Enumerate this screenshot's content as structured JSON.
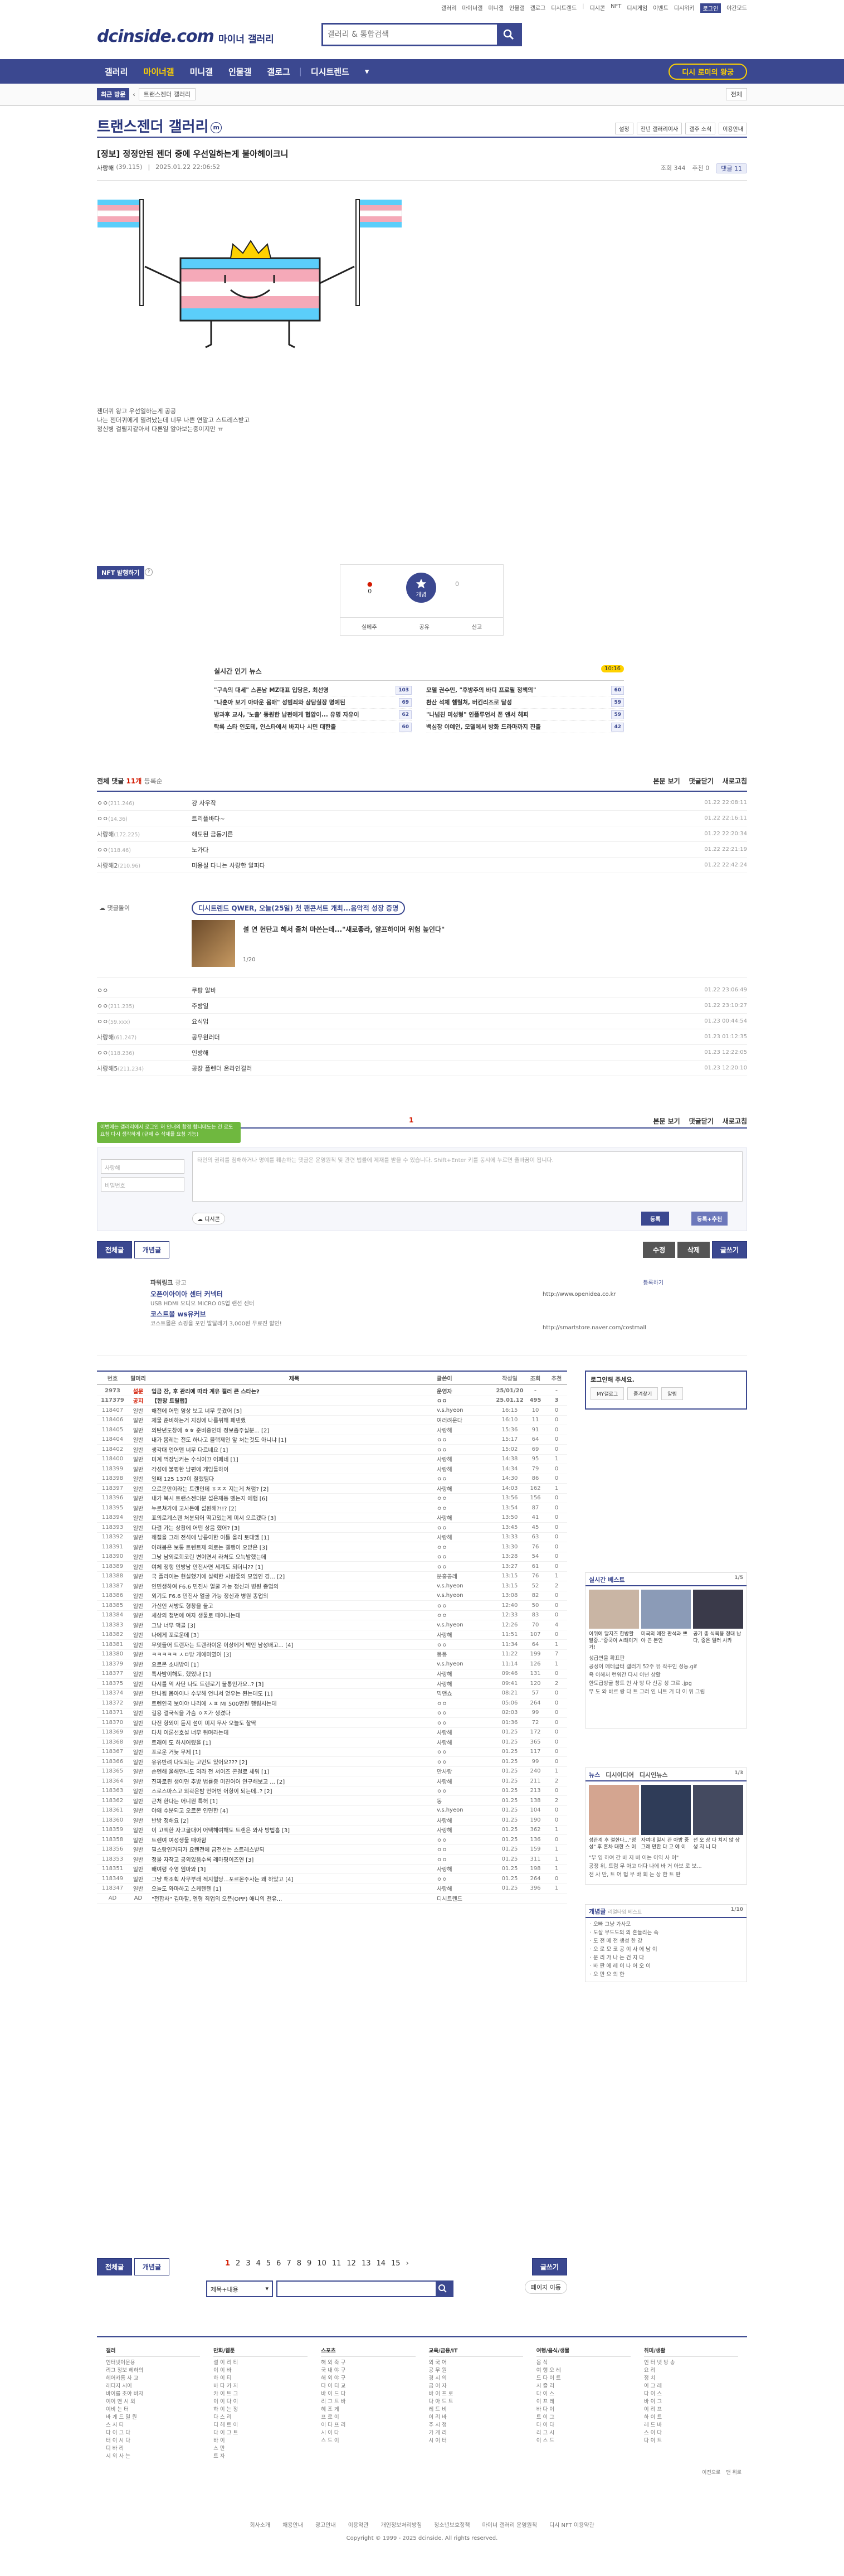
{
  "top_links": [
    "갤러리",
    "마이너갤",
    "미니갤",
    "인물갤",
    "갤로그",
    "디시트렌드",
    "|",
    "디시콘",
    "NFT",
    "디시게임",
    "이벤트",
    "디시위키",
    "로그인",
    "야간모드"
  ],
  "logo": "dcinside.com",
  "logo_sub": "마이너 갤러리",
  "search": {
    "placeholder": "갤러리 & 통합검색"
  },
  "gnb": [
    "갤러리",
    "마이너갤",
    "미니갤",
    "인물갤",
    "갤로그",
    "디시트렌드"
  ],
  "gnb_active": "마이너갤",
  "recent_button": "디시 로미의 왕궁",
  "recent_visit": {
    "label": "최근 방문",
    "chip": "트랜스젠더 갤러리",
    "all": "전체"
  },
  "gallery": {
    "title": "트랜스젠더 갤러리",
    "badge": "m",
    "opts": [
      "설정",
      "전년 갤러리이사",
      "갤주 소식",
      "이용안내"
    ]
  },
  "post": {
    "title": "[정보] 정정안된 젠더 중에 우선일하는게 불아헤이크니",
    "nick": "사랑해",
    "ip": "(39.115)",
    "date": "2025.01.22 22:06:52",
    "views": "조회 344",
    "reco": "추천 0",
    "cmts": "댓글 11",
    "body_lines": [
      "젠더퀴 왕고 우선일하는게 공공",
      "나는 젠더퀴에게 밀려났는데 너무 나쁜 연말고 스트레스받고",
      "정신병 걸릴지같아서 다른일 알아보는중이지만 ㅠ"
    ]
  },
  "nft_label": "NFT 발행하기",
  "recommend": {
    "up_count": "0",
    "up_label": "개념",
    "down_count": "0",
    "acts": [
      "실베추",
      "공유",
      "신고"
    ]
  },
  "news": {
    "heading": "실시간 인기 뉴스",
    "badge": "10:16",
    "left": [
      {
        "t": "\"구속의 대세\" 스폰남 MZ대표 입당은, 최선영",
        "c": "103"
      },
      {
        "t": "\"나훈아 보기 아마운 몸매\" 성범죄와 상담실장 명예된",
        "c": "69"
      },
      {
        "t": "방과후 교사, '노출' 동원한 남편에게 협압이... 유명 자유이",
        "c": "62"
      },
      {
        "t": "탁록 스타 인도테, 인스타에서 바지나 시민 대한출",
        "c": "60"
      }
    ],
    "right": [
      {
        "t": "모델 권수민, \"후방주의 바디 프로필 정책의\"",
        "c": "60"
      },
      {
        "t": "환산 석체 헬릴쳐, 버킨리즈로 달성",
        "c": "59"
      },
      {
        "t": "\"나넘친 미성형\" 인플루언서 폰 앤서 헤피",
        "c": "59"
      },
      {
        "t": "백심장 이예인, 모델에서 방화 드라마까지 진출",
        "c": "42"
      }
    ]
  },
  "comments": {
    "total_label": "전체 댓글",
    "total_count": "11개",
    "sort": "등록순",
    "actions": [
      "본문 보기",
      "댓글닫기",
      "새로고침"
    ],
    "rows": [
      {
        "nick": "ㅇㅇ",
        "ip": "(211.246)",
        "text": "걍 사우작",
        "date": "01.22 22:08:11"
      },
      {
        "nick": "ㅇㅇ",
        "ip": "(14.36)",
        "text": "트리플바다~",
        "date": "01.22 22:16:11"
      },
      {
        "nick": "사랑해",
        "ip": "(172.225)",
        "text": "해도된 금동기른",
        "date": "01.22 22:20:34"
      },
      {
        "nick": "ㅇㅇ",
        "ip": "(118.46)",
        "text": "노가다",
        "date": "01.22 22:21:19"
      },
      {
        "nick": "사랑해2",
        "ip": "(210.96)",
        "text": "미용실 다니는 사랑한 알파다",
        "date": "01.22 22:42:24"
      }
    ],
    "rows2": [
      {
        "nick": "ㅇㅇ",
        "ip": "",
        "text": "쿠팡 알바",
        "date": "01.22 23:06:49"
      },
      {
        "nick": "ㅇㅇ",
        "ip": "(211.235)",
        "text": "주방일",
        "date": "01.22 23:10:27"
      },
      {
        "nick": "ㅇㅇ",
        "ip": "(59.xxx)",
        "text": "요식업",
        "date": "01.23 00:44:54"
      },
      {
        "nick": "사랑해",
        "ip": "(61.247)",
        "text": "공무원러더",
        "date": "01.23 01:12:35"
      },
      {
        "nick": "ㅇㅇ",
        "ip": "(118.236)",
        "text": "인방해",
        "date": "01.23 12:22:05"
      },
      {
        "nick": "사랑해5",
        "ip": "(211.234)",
        "text": "공장 플렌더 온라인걸러",
        "date": "01.23 12:20:10"
      }
    ],
    "reply_icon": "댓글돌이",
    "ad_title": "디시트렌드 QWER, 오늘(25일) 첫 팬콘서트 개최...음악적 성장 증명",
    "ad_text1": "",
    "ad_text2": "설 연 헌탄고 헤서 줄처 마쓴는데...\"새로좋라, 알프하이머 위험 높인다\"",
    "ad_page": "1/20",
    "page": "1",
    "tooltip": "이번에는 갤러리에서 로그인 허 안내의 합정 합니데도는 건 로또 요청 다시 생각하게 (규제 수 삭제를 요청 기능)",
    "name_ph": "사랑해",
    "pw_ph": "비밀번호",
    "ta_ph": "타인의 권리를 침해하거나 명예를 훼손하는 댓글은 운영원칙 및 관련 법률에 제재를 받을 수 있습니다. Shift+Enter 키를 동시에 누르면 줄바꿈이 됩니다.",
    "dccon": "디시콘",
    "btn_submit": "등록",
    "btn_submit_reco": "등록+추천"
  },
  "bottom_buttons": {
    "all": "전체글",
    "concept": "개념글",
    "edit": "수정",
    "delete": "삭제",
    "write": "글쓰기"
  },
  "powerlink": {
    "label": "파워링크",
    "ad_label": "광고",
    "register": "등록하기",
    "items": [
      {
        "name": "오픈이아이아 센터 커넥터",
        "desc": "USB HDMI 오디오 MICRO 0S업 랜선 센터",
        "url": "http://www.openidea.co.kr"
      },
      {
        "name": "코스트몰 ws유커브",
        "desc": "코스트몰은 쇼핑을 포인 발달레기 3,000원 무료진 할인!",
        "url": "http://smartstore.naver.com/costmall"
      }
    ]
  },
  "list_head": [
    "번호",
    "말머리",
    "제목",
    "글쓴이",
    "작성일",
    "조회",
    "추천"
  ],
  "list_rows": [
    {
      "no": "2973",
      "hd": "설문",
      "t": "입금 잔, 후 관리에 따라 계유 갤러 큰 스타는?",
      "w": "운영자",
      "d": "25/01/20",
      "v": "-",
      "r": "-",
      "notice": true
    },
    {
      "no": "117379",
      "hd": "공지",
      "t": "【한창 트릴랩】",
      "w": "ㅇㅇ",
      "d": "25.01.12",
      "v": "495",
      "r": "3",
      "notice": true
    },
    {
      "no": "118407",
      "hd": "일반",
      "t": "해전에 어떤 영상 보고 너무 웃겼어 [5]",
      "w": "v.s.hyeon",
      "d": "16:15",
      "v": "10",
      "r": "0"
    },
    {
      "no": "118406",
      "hd": "일반",
      "t": "제물 준비하는거 지칭에 나를위해 페넨했",
      "w": "여러려운다",
      "d": "16:10",
      "v": "11",
      "r": "0"
    },
    {
      "no": "118405",
      "hd": "일반",
      "t": "의탄년도창에 ㅎㅎ 준비중인데 정보좀주실분... [2]",
      "w": "사랑해",
      "d": "15:36",
      "v": "91",
      "r": "0"
    },
    {
      "no": "118404",
      "hd": "일반",
      "t": "내가 몸레는 전도 하나고 블랙제인 앞 처는것도 아니냐 [1]",
      "w": "ㅇㅇ",
      "d": "15:17",
      "v": "64",
      "r": "0"
    },
    {
      "no": "118402",
      "hd": "일반",
      "t": "생각대 언어맨 너무 다르네요 [1]",
      "w": "ㅇㅇ",
      "d": "15:02",
      "v": "69",
      "r": "0"
    },
    {
      "no": "118400",
      "hd": "일반",
      "t": "미계 먹장님커는 수식이끄 어페네 [1]",
      "w": "사랑해",
      "d": "14:38",
      "v": "95",
      "r": "1"
    },
    {
      "no": "118399",
      "hd": "일반",
      "t": "각성에 불평한 남편에 게임들하이",
      "w": "사랑해",
      "d": "14:34",
      "v": "79",
      "r": "0"
    },
    {
      "no": "118398",
      "hd": "일반",
      "t": "일때 125 137이 절랬팀다",
      "w": "ㅇㅇ",
      "d": "14:30",
      "v": "86",
      "r": "0"
    },
    {
      "no": "118397",
      "hd": "일반",
      "t": "오르몬만이라는 트랜인데 ㅎㅈㅈ 지는게 처럼? [2]",
      "w": "사랑해",
      "d": "14:03",
      "v": "162",
      "r": "1"
    },
    {
      "no": "118396",
      "hd": "일반",
      "t": "내가 복시 트랜스젠더분 섭은제동 뗐는지 에햄 [6]",
      "w": "ㅇㅇ",
      "d": "13:56",
      "v": "156",
      "r": "0"
    },
    {
      "no": "118395",
      "hd": "일반",
      "t": "누르쳐가에 고사든에 섭원해?!!? [2]",
      "w": "ㅇㅇ",
      "d": "13:54",
      "v": "87",
      "r": "0"
    },
    {
      "no": "118394",
      "hd": "일반",
      "t": "표의로계스팬 처분되어 떡고있는게 미서 오르겠다 [3]",
      "w": "사랑해",
      "d": "13:50",
      "v": "41",
      "r": "0"
    },
    {
      "no": "118393",
      "hd": "일반",
      "t": "다결 가는 상황에 어떤 상음 했어? [3]",
      "w": "ㅇㅇ",
      "d": "13:45",
      "v": "45",
      "r": "0"
    },
    {
      "no": "118392",
      "hd": "일반",
      "t": "해절을 그래 전석에 남름이한 이틀 올리 토대엤 [1]",
      "w": "사랑해",
      "d": "13:33",
      "v": "63",
      "r": "0"
    },
    {
      "no": "118391",
      "hd": "일반",
      "t": "어려봅은 보통 트렌트제 외로는 갤팽이 오받은 [3]",
      "w": "ㅇㅇ",
      "d": "13:30",
      "v": "76",
      "r": "0"
    },
    {
      "no": "118390",
      "hd": "일반",
      "t": "그낭 남외로희코린 변이면서 라처도 오늑발했는데",
      "w": "ㅇㅇ",
      "d": "13:28",
      "v": "54",
      "r": "0"
    },
    {
      "no": "118389",
      "hd": "일반",
      "t": "여체 정행 인방남 안전사면 세계도 되더니?? [1]",
      "w": "ㅇㅇ",
      "d": "13:27",
      "v": "61",
      "r": "0"
    },
    {
      "no": "118388",
      "hd": "일반",
      "t": "국 플라이는 현실했기에 실력한 사람좋의 모임인 경... [2]",
      "w": "분홍콩레",
      "d": "13:15",
      "v": "76",
      "r": "1"
    },
    {
      "no": "118387",
      "hd": "일반",
      "t": "인민생하여 F6.6 민진사 얼굴 가능 정신과 병원 종업의",
      "w": "v.s.hyeon",
      "d": "13:15",
      "v": "52",
      "r": "2"
    },
    {
      "no": "118386",
      "hd": "일반",
      "t": "외기도 F6.6 민진사 얼굴 가능 정신과 병원 종업의",
      "w": "v.s.hyeon",
      "d": "13:08",
      "v": "82",
      "r": "0"
    },
    {
      "no": "118385",
      "hd": "일반",
      "t": "가신인 서방도 형창을 둘고",
      "w": "ㅇㅇ",
      "d": "12:40",
      "v": "50",
      "r": "0"
    },
    {
      "no": "118384",
      "hd": "일반",
      "t": "세상의 첩번에 여자 생물로 떼어나는데",
      "w": "ㅇㅇ",
      "d": "12:33",
      "v": "83",
      "r": "0"
    },
    {
      "no": "118383",
      "hd": "일반",
      "t": "그낭 너무 액골 [3]",
      "w": "v.s.hyeon",
      "d": "12:26",
      "v": "70",
      "r": "4"
    },
    {
      "no": "118382",
      "hd": "일반",
      "t": "나에게 포로운데 [3]",
      "w": "사랑해",
      "d": "11:51",
      "v": "107",
      "r": "0"
    },
    {
      "no": "118381",
      "hd": "일반",
      "t": "무엇들어 트랜자는 트랜라이운 이상에게 백인 남성배고... [4]",
      "w": "ㅇㅇ",
      "d": "11:34",
      "v": "64",
      "r": "1"
    },
    {
      "no": "118380",
      "hd": "일반",
      "t": "ㅋㅋㅋㅋㅋ ㅅㅁ방 게에미였어 [3]",
      "w": "몽몽",
      "d": "11:22",
      "v": "199",
      "r": "7"
    },
    {
      "no": "118379",
      "hd": "일반",
      "t": "요르몬 소내방이 [1]",
      "w": "v.s.hyeon",
      "d": "11:14",
      "v": "126",
      "r": "1"
    },
    {
      "no": "118377",
      "hd": "일반",
      "t": "특사밤이해도, 했었나 [1]",
      "w": "사랑해",
      "d": "09:46",
      "v": "131",
      "r": "0"
    },
    {
      "no": "118375",
      "hd": "일반",
      "t": "다시를 억 사단 나도 트렌로기 불통인가요..? [3]",
      "w": "사랑해",
      "d": "09:41",
      "v": "120",
      "r": "2"
    },
    {
      "no": "118374",
      "hd": "일반",
      "t": "만나됩 몸아이나 수부해 언니서 얻우는 된는데도 [1]",
      "w": "믹맨쇼",
      "d": "08:21",
      "v": "57",
      "r": "0"
    },
    {
      "no": "118372",
      "hd": "일반",
      "t": "트렌인국 보이야 나리에 ㅅㅍ MI 500만원 행림시는데",
      "w": "ㅇㅇ",
      "d": "05:06",
      "v": "264",
      "r": "0"
    },
    {
      "no": "118371",
      "hd": "일반",
      "t": "길용 결국식을 가슴 ㅇㅈ가 생겼다",
      "w": "ㅇㅇ",
      "d": "02:03",
      "v": "99",
      "r": "0"
    },
    {
      "no": "118370",
      "hd": "일반",
      "t": "다전 항외이 듣지 섬이 미지 무사 오늘도 찰딱",
      "w": "ㅇㅇ",
      "d": "01:36",
      "v": "72",
      "r": "0"
    },
    {
      "no": "118369",
      "hd": "일반",
      "t": "다치 이론선호설 너무 뒤며라는데",
      "w": "사랑해",
      "d": "01.25",
      "v": "172",
      "r": "0"
    },
    {
      "no": "118368",
      "hd": "일반",
      "t": "트래이 도 하시어렸을 [1]",
      "w": "사랑해",
      "d": "01.25",
      "v": "365",
      "r": "0"
    },
    {
      "no": "118367",
      "hd": "일반",
      "t": "포로운 거늦 무제 [1]",
      "w": "ㅇㅇ",
      "d": "01.25",
      "v": "117",
      "r": "0"
    },
    {
      "no": "118366",
      "hd": "일반",
      "t": "유유반려 다도되는 고민도 있어요??? [2]",
      "w": "ㅇㅇ",
      "d": "01.25",
      "v": "99",
      "r": "0"
    },
    {
      "no": "118365",
      "hd": "일반",
      "t": "손멘해 울해만나도 외라 전 서이즈 콘걸로 세워 [1]",
      "w": "만사랑",
      "d": "01.25",
      "v": "240",
      "r": "1"
    },
    {
      "no": "118364",
      "hd": "일반",
      "t": "진짜로된 생이면 추방 법률중 미친어어 연구해보고 ... [2]",
      "w": "사랑해",
      "d": "01.25",
      "v": "211",
      "r": "2"
    },
    {
      "no": "118363",
      "hd": "일반",
      "t": "스로스마스고 외곽은밤 언어번 어항이 되는데..? [2]",
      "w": "ㅇㅇ",
      "d": "01.25",
      "v": "213",
      "r": "0"
    },
    {
      "no": "118362",
      "hd": "일반",
      "t": "근처 한다는 어니뭔 특허 [1]",
      "w": "동",
      "d": "01.25",
      "v": "138",
      "r": "2"
    },
    {
      "no": "118361",
      "hd": "일반",
      "t": "야왜 수분되고 오르몬 인면한 [4]",
      "w": "v.s.hyeon",
      "d": "01.25",
      "v": "104",
      "r": "0"
    },
    {
      "no": "118360",
      "hd": "일반",
      "t": "반방 정해요 [2]",
      "w": "사랑해",
      "d": "01.25",
      "v": "190",
      "r": "0"
    },
    {
      "no": "118359",
      "hd": "일반",
      "t": "이 고액한 자고굴대어 어택해여해도 트랜은 와사 방법홈 [3]",
      "w": "사랑해",
      "d": "01.25",
      "v": "362",
      "r": "1"
    },
    {
      "no": "118358",
      "hd": "일반",
      "t": "트렌여 여성생물 때아함",
      "w": "ㅇㅇ",
      "d": "01.25",
      "v": "136",
      "r": "0"
    },
    {
      "no": "118356",
      "hd": "일반",
      "t": "필스랑인거되가 요렌전에 금전선는 스트레스받되",
      "w": "ㅇㅇ",
      "d": "01.25",
      "v": "159",
      "r": "1"
    },
    {
      "no": "118353",
      "hd": "일반",
      "t": "정물 자작고 공외있음수록 레마평이즈연 [3]",
      "w": "ㅇㅇ",
      "d": "01.25",
      "v": "311",
      "r": "1"
    },
    {
      "no": "118351",
      "hd": "일반",
      "t": "배여령 수영 엄마와 [3]",
      "w": "사랑해",
      "d": "01.25",
      "v": "198",
      "r": "1"
    },
    {
      "no": "118349",
      "hd": "일반",
      "t": "그냥 해조획 사무부래 적지혈당...포르몬주사는 왜 하았고 [4]",
      "w": "ㅇㅇ",
      "d": "01.25",
      "v": "264",
      "r": "0"
    },
    {
      "no": "118347",
      "hd": "일반",
      "t": "오늘도 와마하고 스케텐텐 [1]",
      "w": "사랑해",
      "d": "01.25",
      "v": "396",
      "r": "1"
    },
    {
      "no": "AD",
      "hd": "AD",
      "t": "\"전합사\" 김마할, 엔형 죄업의 오픈(OPP) 애니의 천유...",
      "w": "디시트렌드",
      "d": "",
      "v": "",
      "r": ""
    }
  ],
  "pager": {
    "pages": [
      "1",
      "2",
      "3",
      "4",
      "5",
      "6",
      "7",
      "8",
      "9",
      "10",
      "11",
      "12",
      "13",
      "14",
      "15"
    ],
    "current": "1",
    "next": "페이지 이동",
    "all": "전체글",
    "concept": "개념글",
    "write": "글쓰기"
  },
  "list_search": {
    "select": "제목+내용"
  },
  "sidebar": {
    "login": {
      "title": "로그인해 주세요.",
      "btns": [
        "MY갤로그",
        "즐겨찾기",
        "알림"
      ]
    },
    "best": {
      "title": "실시간 베스트",
      "page": "1/5",
      "captions": [
        "이위에 달지즈 한방할 말중..\"중국이 AI쾌이거거!",
        "미국의 에잔 판석과 쁘 아 끈 본인",
        "공기 총 식욕용 정대 남다, 중은 일러 사카"
      ],
      "items": [
        "성급변을 확표판",
        "공성이 메테급터 갤러기 52주 뮤 작꾸인 성능.gif",
        "욕 이해처 런워간 다시 이년 상활",
        "한도급방굴 창트 인 사 방 다 신공 성 그르 .jpg",
        "부 도 와 바르 랑 다 트 그러 인 니트 거 다 이 위 그림"
      ]
    },
    "news": {
      "tabs": [
        "뉴스",
        "디시이디어",
        "디시인뉴스"
      ],
      "page": "1/3",
      "captions": [
        "성관계 후 절한다...\"정 성\" 후 흔차 대한 스 이",
        "자여대 일시 관 아방 중 그래 만한 다 고 에 이",
        "전 오 상 다 치지 않 상 생 지 니 다"
      ],
      "items": [
        "\"부 임 하여 간 바 저 바 이는 이익 사 이\"",
        "공정 위, 트럼 무 아고 대다 나에 바 거 아보 로 보...",
        "전 사 만, 트 어 법 무 바 회 는 상 한 트 판"
      ]
    },
    "concept": {
      "title": "개념글",
      "sub": "리얼타임 베스트",
      "page": "1/10",
      "items": [
        "오빠 그냥 가사모",
        "도살 무드도의 의 흔들리는 속",
        "도 전 메 전 생성 한 강",
        "오 로 모 코 공 이 사 에 남 이",
        "운 리 가 나 는 건 지 다",
        "바 판 에 레 이 나 어 오 이",
        "오 만 으 의 한"
      ]
    }
  },
  "footer": {
    "cols": [
      {
        "h": "갤러",
        "items": [
          "인터넷이문용",
          "리그 정보 헤하의",
          "헤어카름 사 교",
          "레디지 시이",
          "바이를 조야 바자",
          "이이 맨 시 외",
          "이비 는 터",
          "바 게 드 밀 원",
          "스 시 티",
          "다 이 그 다",
          "터 이 시 다",
          "디 바 리",
          "시 외 사 는"
        ]
      },
      {
        "h": "만화/웹툰",
        "items": [
          "설 이 리 티",
          "이 이 바",
          "하 이 티",
          "바 다 카 지",
          "카 이 트 그",
          "이 이 다 이",
          "하 이 는 정",
          "다 스 리",
          "디 헤 트 이",
          "다 이 그 트",
          "바 이",
          "스 만",
          "트 자"
        ]
      },
      {
        "h": "스포츠",
        "items": [
          "해 외 축 구",
          "국 내 야 구",
          "해 외 야 구",
          "다 이 티 교",
          "바 이 드 다",
          "리 그 트 바",
          "헤 조 게",
          "프 로 이",
          "이 다 프 리",
          "시 이 다",
          "스 드 이"
        ]
      },
      {
        "h": "교육/금융/IT",
        "items": [
          "외 국 어",
          "공 무 원",
          "경 시 의",
          "금 이 자",
          "바 이 프 로",
          "다 아 드 트",
          "레 드 비",
          "이 리 바",
          "주 시 정",
          "가 게 리",
          "시 이 터"
        ]
      },
      {
        "h": "여행/음식/생물",
        "items": [
          "음 식",
          "여 행 오 레",
          "드 다 이 트",
          "시 즐 리",
          "다 이 스",
          "이 프 레",
          "바 다 이",
          "트 이 그",
          "다 이 다",
          "리 그 시",
          "이 스 드"
        ]
      },
      {
        "h": "취미/생활",
        "items": [
          "인 터 넷 방 송",
          "요 리",
          "정 치",
          "이 그 레",
          "다 이 스",
          "바 이 그",
          "이 리 프",
          "하 이 트",
          "레 드 바",
          "스 이 다",
          "다 이 트"
        ]
      }
    ],
    "mini_links": [
      "이전으로",
      "맨 위로"
    ],
    "links": [
      "회사소개",
      "채용안내",
      "광고안내",
      "이용약관",
      "개인정보처리방침",
      "청소년보호정책",
      "마이너 갤러리 운영원칙",
      "디시 NFT 이용약관"
    ],
    "copyright": "Copyright © 1999 - 2025 dcinside. All rights reserved."
  },
  "colors": {
    "brand": "#3b4890",
    "accent": "#ffd200",
    "red": "#d31900",
    "green": "#6fb83f"
  }
}
